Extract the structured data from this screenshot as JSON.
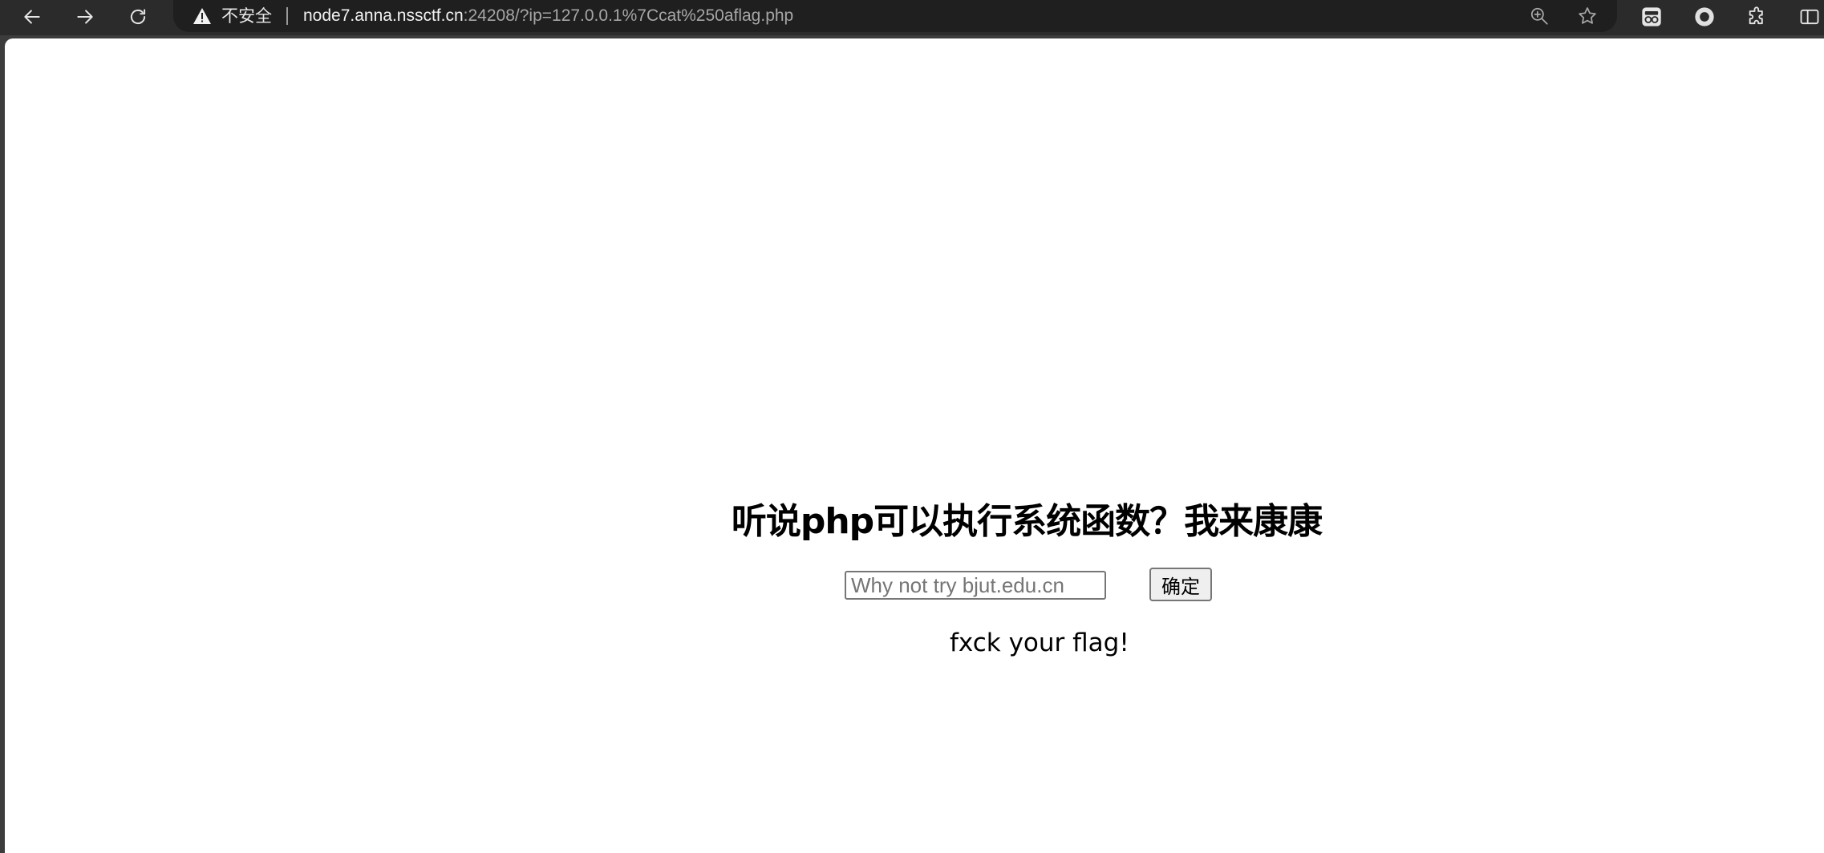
{
  "browser": {
    "security_label": "不安全",
    "url_host": "node7.anna.nssctf.cn",
    "url_rest": ":24208/?ip=127.0.0.1%7Ccat%250aflag.php",
    "icons": {
      "back": "arrow-left-icon",
      "forward": "arrow-right-icon",
      "reload": "reload-icon",
      "warning": "warning-triangle-icon",
      "zoom": "zoom-in-icon",
      "bookmark": "star-icon",
      "extensions": [
        "incognito-extension-icon",
        "circle-extension-icon",
        "puzzle-icon",
        "split-view-icon"
      ]
    }
  },
  "page": {
    "heading": "听说php可以执行系统函数？我来康康",
    "input_placeholder": "Why not try bjut.edu.cn",
    "input_value": "",
    "submit_label": "确定",
    "result_text": "fxck your flag!"
  }
}
